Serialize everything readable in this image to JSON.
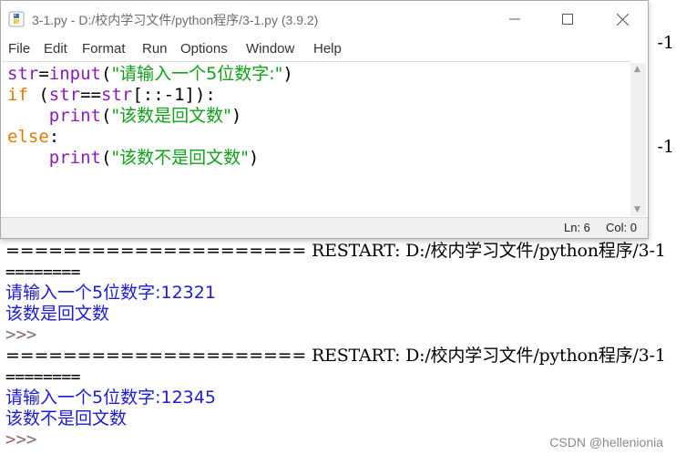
{
  "editor": {
    "title": "3-1.py - D:/校内学习文件/python程序/3-1.py (3.9.2)",
    "menu": [
      "File",
      "Edit",
      "Format",
      "Run",
      "Options",
      "Window",
      "Help"
    ],
    "code": {
      "l1_var": "str",
      "l1_eq": "=",
      "l1_func": "input",
      "l1_open": "(",
      "l1_str": "\"请输入一个5位数字:\"",
      "l1_close": ")",
      "l2_kw": "if",
      "l2_rest1": " (",
      "l2_var": "str",
      "l2_eq": "==",
      "l2_func": "str",
      "l2_rest2": "[::-1]):",
      "l3_indent": "    ",
      "l3_func": "print",
      "l3_open": "(",
      "l3_str": "\"该数是回文数\"",
      "l3_close": ")",
      "l4_kw": "else",
      "l4_colon": ":",
      "l5_indent": "    ",
      "l5_func": "print",
      "l5_open": "(",
      "l5_str": "\"该数不是回文数\"",
      "l5_close": ")"
    },
    "status_line": "Ln: 6",
    "status_col": "Col: 0"
  },
  "shell": {
    "peek_right": "-1",
    "lines": [
      {
        "kind": "restart",
        "text": "===================== RESTART: D:/校内学习文件/python程序/3-1"
      },
      {
        "kind": "eq",
        "text": "========"
      },
      {
        "kind": "out",
        "text": "请输入一个5位数字:12321"
      },
      {
        "kind": "out",
        "text": "该数是回文数"
      },
      {
        "kind": "prompt",
        "text": ">>>"
      },
      {
        "kind": "restart",
        "text": "===================== RESTART: D:/校内学习文件/python程序/3-1"
      },
      {
        "kind": "eq",
        "text": "========"
      },
      {
        "kind": "out",
        "text": "请输入一个5位数字:12345"
      },
      {
        "kind": "out",
        "text": "该数不是回文数"
      },
      {
        "kind": "prompt",
        "text": ">>>"
      }
    ],
    "watermark": "CSDN @hellenionia"
  },
  "colors": {
    "keyword": "#e07b00",
    "builtin": "#8b1bbd",
    "string": "#11a11a",
    "output": "#1c1cd6"
  }
}
